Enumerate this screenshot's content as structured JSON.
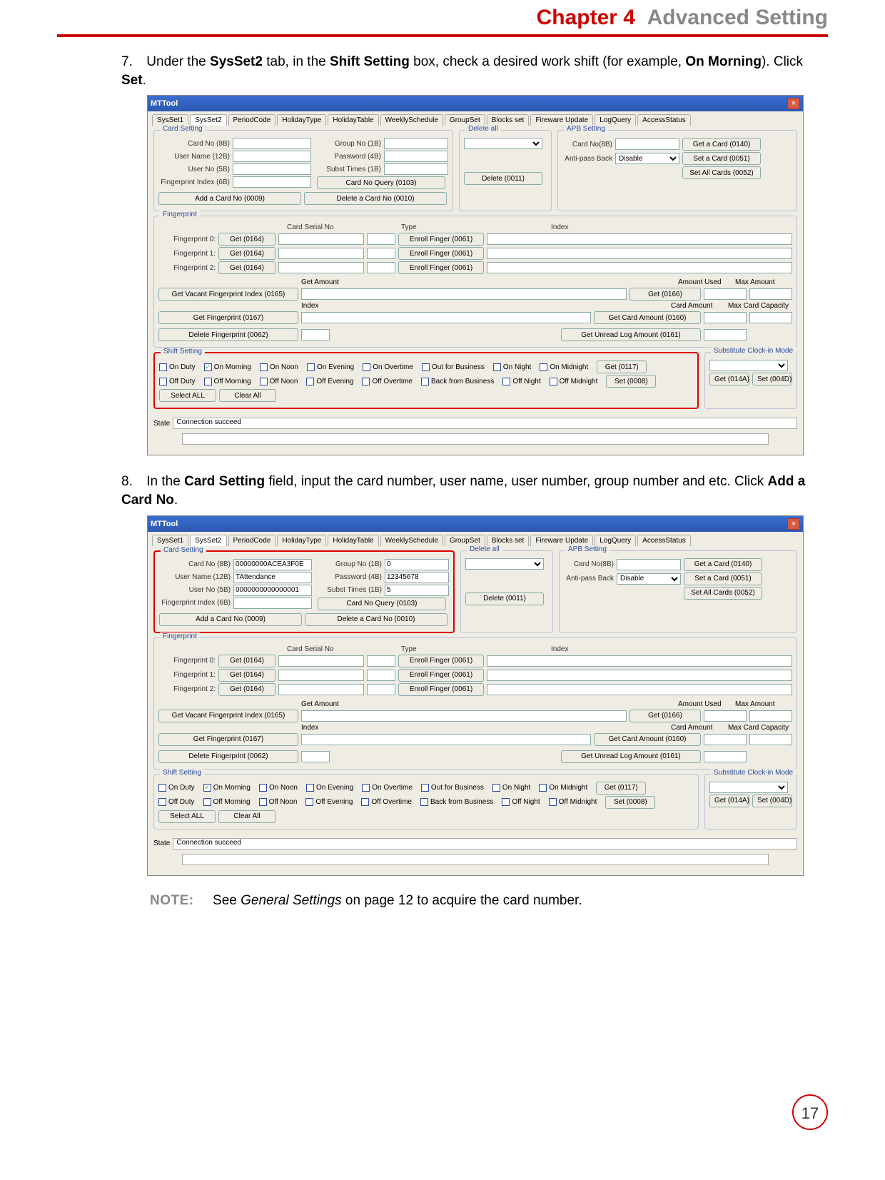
{
  "header": {
    "chapter": "Chapter 4",
    "title": "Advanced Setting"
  },
  "step7": {
    "num": "7.",
    "t1": "Under the ",
    "b1": "SysSet2",
    "t2": " tab, in the ",
    "b2": "Shift Setting",
    "t3": " box, check a desired work shift (for example, ",
    "b3": "On Morning",
    "t4": "). Click ",
    "b4": "Set",
    "t5": "."
  },
  "step8": {
    "num": "8.",
    "t1": "In the ",
    "b1": "Card Setting",
    "t2": " field, input the card number, user name, user number, group number and etc. Click ",
    "b2": "Add a Card No",
    "t3": "."
  },
  "note": {
    "label": "NOTE:",
    "lead": "See ",
    "em": "General Settings",
    "tail": " on page 12 to acquire the card number."
  },
  "pagenum": "17",
  "win": {
    "title": "MTTool",
    "tabs": [
      "SysSet1",
      "SysSet2",
      "PeriodCode",
      "HolidayType",
      "HolidayTable",
      "WeeklySchedule",
      "GroupSet",
      "Blocks set",
      "Fireware Update",
      "LogQuery",
      "AccessStatus"
    ],
    "tab_active": 1,
    "cardSetting": {
      "title": "Card Setting",
      "cardNo_lbl": "Card No (8B)",
      "userName_lbl": "User Name (12B)",
      "userNo_lbl": "User No (5B)",
      "fpIndex_lbl": "Fingerprint Index (6B)",
      "groupNo_lbl": "Group No (1B)",
      "password_lbl": "Password (4B)",
      "subst_lbl": "Subst Times (1B)",
      "btn_cardNoQuery": "Card No Query (0103)",
      "btn_add": "Add a Card No (0009)",
      "btn_delete": "Delete a Card No (0010)"
    },
    "cardSetting_values_fig2": {
      "cardNo": "00000000ACEA3F0E",
      "userName": "TAttendance",
      "userNo": "0000000000000001",
      "groupNo": "0",
      "password": "12345678",
      "subst": "5"
    },
    "deleteAll": {
      "title": "Delete all",
      "btn_delete": "Delete (0011)"
    },
    "apb": {
      "title": "APB Setting",
      "cardNo_lbl": "Card No(8B)",
      "antipass_lbl": "Anti-pass Back",
      "antipass_val": "Disable",
      "btn_get": "Get a Card (0140)",
      "btn_set": "Set a Card (0051)",
      "btn_setAll": "Set All Cards (0052)"
    },
    "fingerprint": {
      "title": "Fingerprint",
      "hdr_serial": "Card Serial No",
      "hdr_type": "Type",
      "hdr_index": "Index",
      "rows": [
        {
          "lbl": "Fingerprint 0:",
          "get": "Get (0164)",
          "enroll": "Enroll Finger (0061)"
        },
        {
          "lbl": "Fingerprint 1:",
          "get": "Get (0164)",
          "enroll": "Enroll Finger (0061)"
        },
        {
          "lbl": "Fingerprint 2:",
          "get": "Get (0164)",
          "enroll": "Enroll Finger (0061)"
        }
      ],
      "getAmount_lbl": "Get Amount",
      "amountUsed_lbl": "Amount Used",
      "maxAmount_lbl": "Max Amount",
      "btn_vacant": "Get Vacant Fingerprint Index (0165)",
      "btn_get0166": "Get (0166)",
      "index_lbl": "Index",
      "cardAmount_lbl": "Card Amount",
      "maxCardCap_lbl": "Max Card Capacity",
      "btn_getFp": "Get Fingerprint (0167)",
      "btn_getCardAmt": "Get Card Amount (0160)",
      "btn_deleteFp": "Delete Fingerprint (0062)",
      "btn_unread": "Get Unread Log Amount (0161)"
    },
    "shift": {
      "title": "Shift Setting",
      "row1": [
        "On Duty",
        "On Morning",
        "On Noon",
        "On Evening",
        "On Overtime",
        "Out for Business",
        "On Night",
        "On Midnight"
      ],
      "row2": [
        "Off Duty",
        "Off Morning",
        "Off Noon",
        "Off Evening",
        "Off Overtime",
        "Back from Business",
        "Off Night",
        "Off Midnight"
      ],
      "checked": "On Morning",
      "btn_get": "Get (0117)",
      "btn_set": "Set (0008)",
      "btn_selectAll": "Select ALL",
      "btn_clearAll": "Clear All"
    },
    "substClock": {
      "title": "Substitute Clock-in Mode",
      "btn_get": "Get (014A)",
      "btn_set": "Set (004D)"
    },
    "state_lbl": "State",
    "state_val": "Connection succeed"
  }
}
